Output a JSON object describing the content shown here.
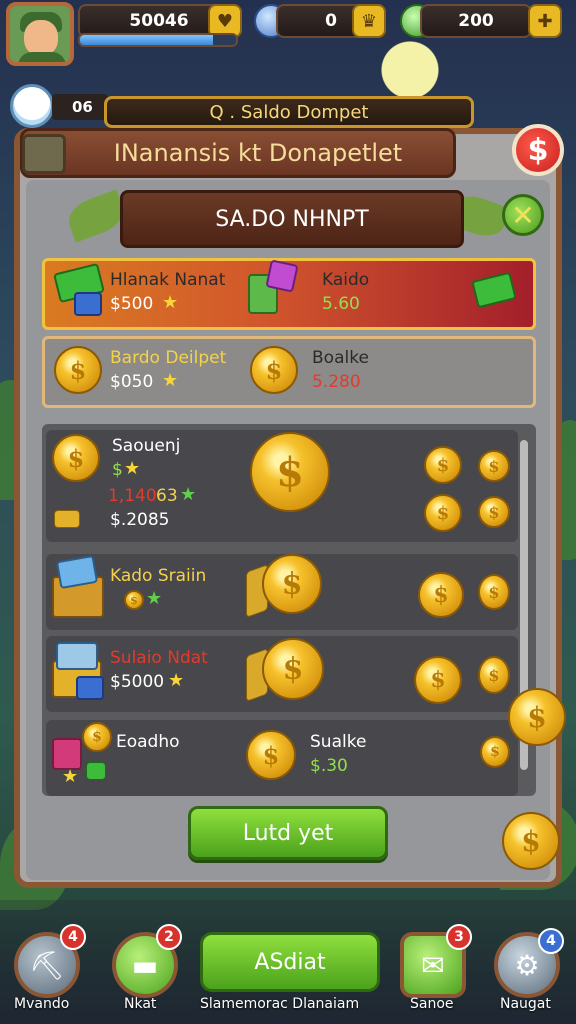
{
  "hud": {
    "coins": "50046",
    "gems_mid": "0",
    "gems_right": "200",
    "xp_progress": 0.85,
    "level": "06",
    "wallet_label": "Q . Saldo Dompet"
  },
  "panel": {
    "title": "INanansis kt Donapetlet",
    "badge": "$",
    "banner": "SA.DO NHNPT",
    "close": "✕"
  },
  "rows": {
    "r1_left_title": "Hlanak Nanat",
    "r1_left_value": "$500",
    "r1_right_title": "Kaido",
    "r1_right_value": "5.60",
    "r2_left_title": "Bardo Deilpet",
    "r2_left_value": "$050",
    "r2_right_title": "Boalke",
    "r2_right_value": "5.280"
  },
  "list": [
    {
      "title": "Saouenj",
      "line2": "$",
      "line3": "1,140",
      "line3b": "63",
      "line4": "$.2085"
    },
    {
      "title": "Kado Sraiin"
    },
    {
      "title": "Sulaio Ndat",
      "value": "$5000"
    },
    {
      "title": "Eoadho",
      "right_title": "Sualke",
      "right_value": "$.30"
    }
  ],
  "claim_label": "Lutd yet",
  "nav": {
    "left1_label": "Mvando",
    "left1_badge": "4",
    "left2_label": "Nkat",
    "left2_badge": "2",
    "center_button": "ASdiat",
    "center_label": "Slamemorac Dlanaiam",
    "right1_label": "Sanoe",
    "right1_badge": "3",
    "right2_label": "Naugat",
    "right2_badge": "4"
  }
}
